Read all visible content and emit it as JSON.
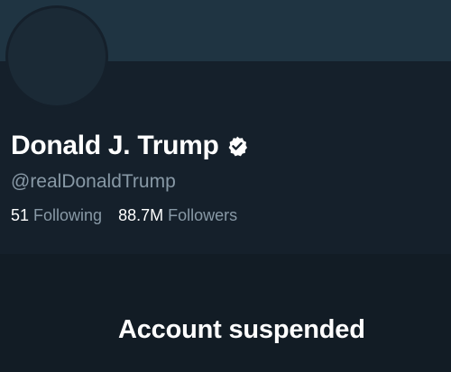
{
  "profile": {
    "display_name": "Donald J. Trump",
    "verified_icon": "verified-badge-icon",
    "handle": "@realDonaldTrump",
    "following_count": "51",
    "following_label": "Following",
    "followers_count": "88.7M",
    "followers_label": "Followers"
  },
  "status": {
    "message": "Account suspended"
  },
  "colors": {
    "background": "#15202b",
    "banner": "#1f3442",
    "secondary_text": "#8899a6",
    "primary_text": "#ffffff"
  }
}
